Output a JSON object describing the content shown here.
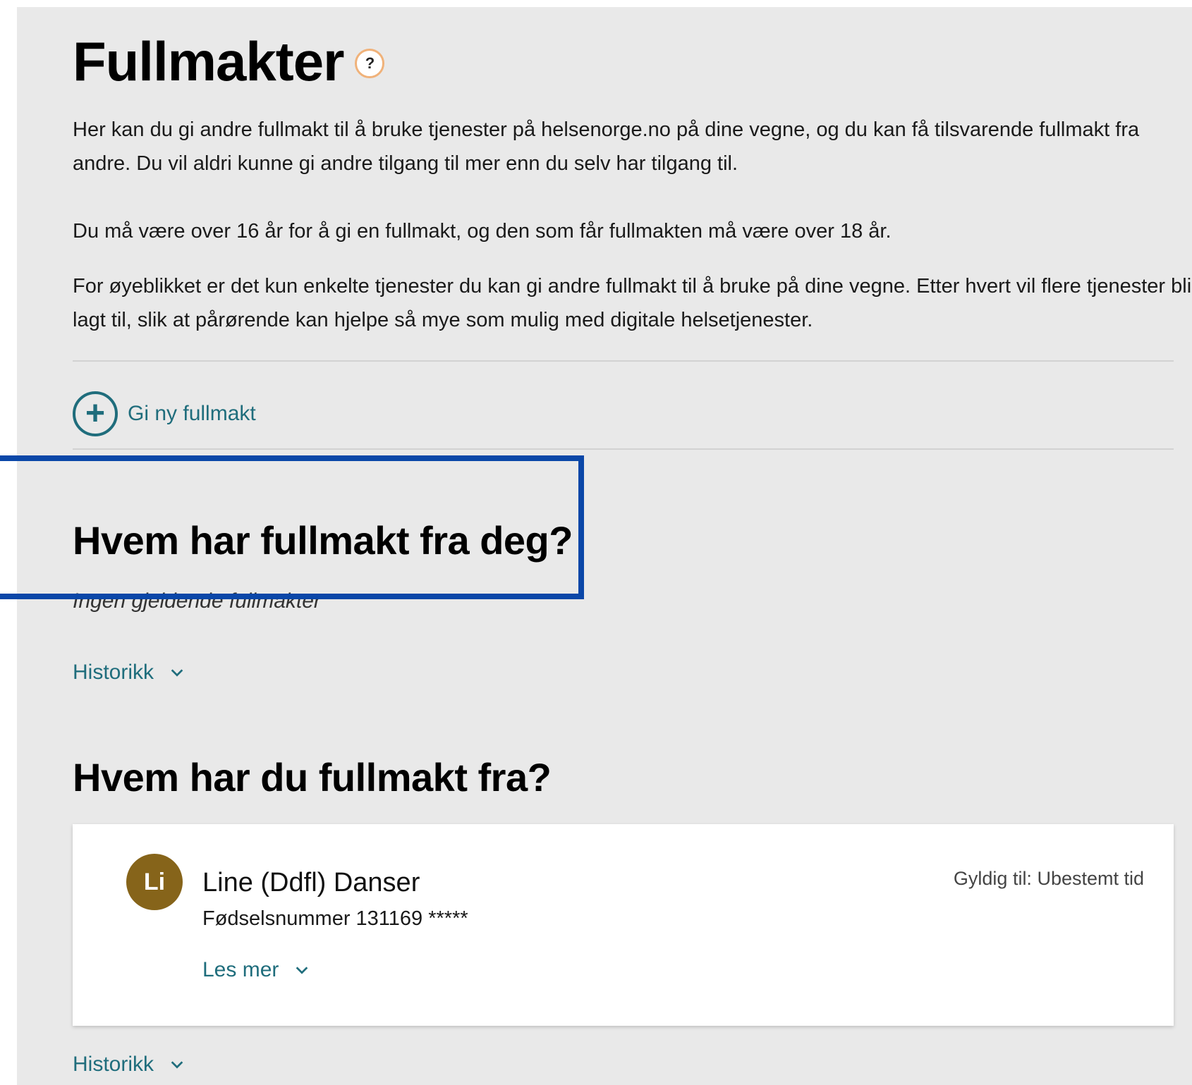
{
  "page": {
    "title": "Fullmakter",
    "help_icon": "question-mark-icon",
    "help_glyph": "?"
  },
  "intro": {
    "p1": "Her kan du gi andre fullmakt til å bruke tjenester på helsenorge.no på dine vegne, og du kan få tilsvarende fullmakt fra andre. Du vil aldri kunne gi andre tilgang til mer enn du selv har tilgang til.",
    "p2": "Du må være over 16 år for å gi en fullmakt, og den som får fullmakten må være over 18 år.",
    "p3": "For øyeblikket er det kun enkelte tjenester du kan gi andre fullmakt til å bruke på dine vegne. Etter hvert vil flere tjenester bli lagt til, slik at pårørende kan hjelpe så mye som mulig med digitale helsetjenester."
  },
  "actions": {
    "new_proxy_label": "Gi ny fullmakt",
    "new_proxy_icon": "plus-circle-icon"
  },
  "given": {
    "heading": "Hvem har fullmakt fra deg?",
    "empty_text": "Ingen gjeldende fullmakter",
    "history_label": "Historikk"
  },
  "received": {
    "heading": "Hvem har du fullmakt fra?",
    "items": [
      {
        "initials": "Li",
        "name": "Line (Ddfl) Danser",
        "id_text": "Fødselsnummer 131169 *****",
        "valid_text": "Gyldig til: Ubestemt tid",
        "read_more_label": "Les mer"
      }
    ],
    "history_label": "Historikk"
  },
  "colors": {
    "panel_bg": "#e9e9e9",
    "link": "#1f6d7c",
    "avatar_bg": "#86641a",
    "highlight_border": "#0a47a8",
    "help_ring": "#f0b27a"
  }
}
